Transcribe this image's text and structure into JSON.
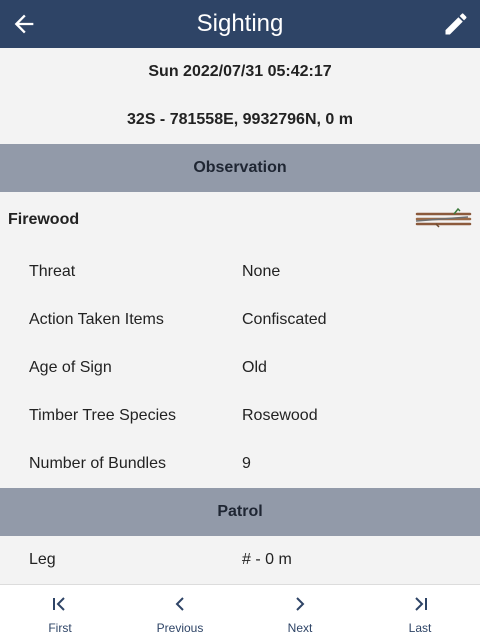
{
  "appbar": {
    "title": "Sighting",
    "back_icon": "arrow-back-icon",
    "edit_icon": "pencil-icon",
    "bg_color": "#2e4466"
  },
  "summary": {
    "datetime": "Sun 2022/07/31 05:42:17",
    "location": "32S - 781558E, 9932796N, 0 m"
  },
  "observation": {
    "header": "Observation",
    "category": {
      "label": "Firewood",
      "icon": "firewood-bundle-icon"
    },
    "fields": [
      {
        "label": "Threat",
        "value": "None"
      },
      {
        "label": "Action Taken Items",
        "value": "Confiscated"
      },
      {
        "label": "Age of Sign",
        "value": "Old"
      },
      {
        "label": "Timber Tree Species",
        "value": "Rosewood"
      },
      {
        "label": "Number of Bundles",
        "value": "9"
      }
    ]
  },
  "patrol": {
    "header": "Patrol",
    "fields": [
      {
        "label": "Leg",
        "value": "# - 0 m"
      }
    ]
  },
  "bottom_nav": [
    {
      "label": "First",
      "icon": "first-page-icon"
    },
    {
      "label": "Previous",
      "icon": "chevron-left-icon"
    },
    {
      "label": "Next",
      "icon": "chevron-right-icon"
    },
    {
      "label": "Last",
      "icon": "last-page-icon"
    }
  ],
  "colors": {
    "section_header_bg": "#929aa9",
    "page_bg": "#f3f3f3",
    "nav_text": "#2e4466"
  }
}
